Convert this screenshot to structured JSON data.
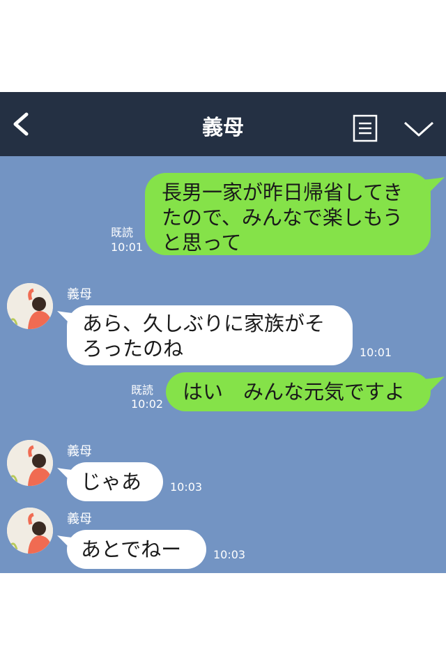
{
  "header": {
    "title": "義母",
    "back_icon": "chevron-left-icon",
    "menu_icon": "list-icon",
    "toggle_icon": "chevron-down-icon"
  },
  "messages": [
    {
      "side": "right",
      "text_lines": [
        "長男一家が昨日帰省してき",
        "たので、みんなで楽しもう",
        "と思って"
      ],
      "read": "既読",
      "time": "10:01"
    },
    {
      "side": "left",
      "sender": "義母",
      "text_lines": [
        "あら、久しぶりに家族がそ",
        "ろったのね"
      ],
      "time": "10:01"
    },
    {
      "side": "right",
      "text_lines": [
        "はい　みんな元気ですよ"
      ],
      "read": "既読",
      "time": "10:02"
    },
    {
      "side": "left",
      "sender": "義母",
      "text_lines": [
        "じゃあ"
      ],
      "time": "10:03"
    },
    {
      "side": "left",
      "sender": "義母",
      "text_lines": [
        "あとでねー"
      ],
      "time": "10:03"
    }
  ],
  "colors": {
    "header_bg": "#243043",
    "chat_bg": "#7394c3",
    "my_bubble": "#85e249",
    "their_bubble": "#ffffff"
  }
}
